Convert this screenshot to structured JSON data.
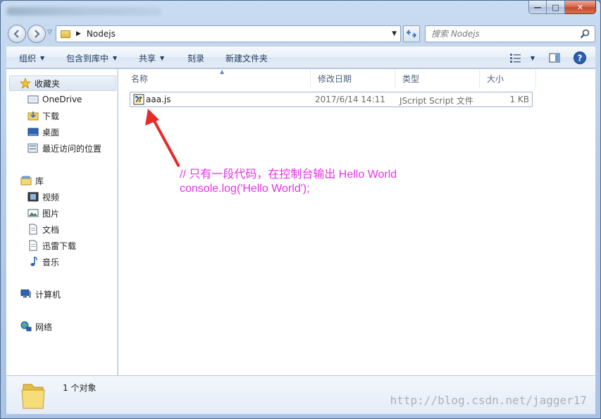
{
  "window": {
    "title": "",
    "caption": {
      "minimize": "—",
      "maximize": "□",
      "close": "✕"
    }
  },
  "address": {
    "path": "Nodejs"
  },
  "search": {
    "placeholder": "搜索 Nodejs"
  },
  "toolbar": {
    "organize": "组织",
    "include_in_library": "包含到库中",
    "share": "共享",
    "burn": "刻录",
    "new_folder": "新建文件夹"
  },
  "sidebar": {
    "favorites": "收藏夹",
    "items_fav": [
      "OneDrive",
      "下载",
      "桌面",
      "最近访问的位置"
    ],
    "libraries": "库",
    "items_lib": [
      "视频",
      "图片",
      "文档",
      "迅雷下载",
      "音乐"
    ],
    "computer": "计算机",
    "network": "网络"
  },
  "columns": {
    "name": "名称",
    "modified": "修改日期",
    "type": "类型",
    "size": "大小"
  },
  "files": [
    {
      "name": "aaa.js",
      "modified": "2017/6/14 14:11",
      "type": "JScript Script 文件",
      "size": "1 KB"
    }
  ],
  "annotation": {
    "line1": "// 只有一段代码，在控制台输出 Hello World",
    "line2": "console.log('Hello World');",
    "color": "#e632e6"
  },
  "status": {
    "count": "1 个对象"
  },
  "watermark": "http://blog.csdn.net/jagger17"
}
